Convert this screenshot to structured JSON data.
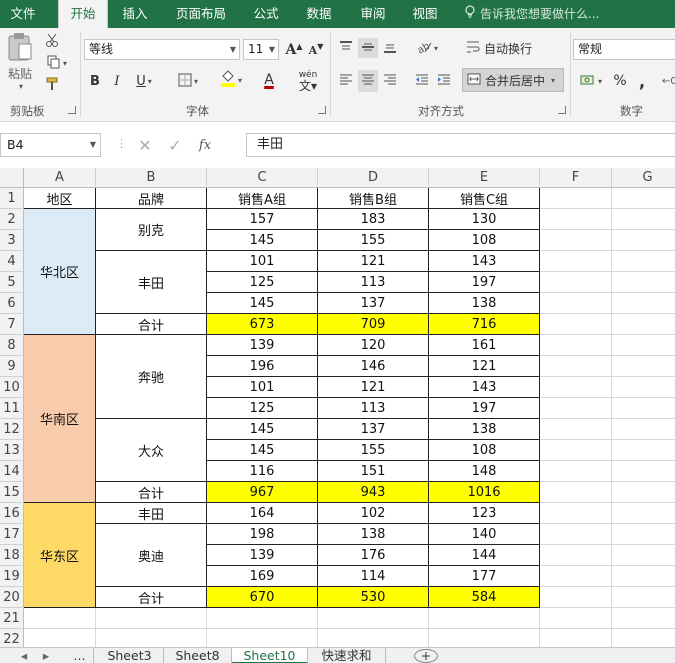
{
  "menu": {
    "tabs": [
      {
        "label": "文件"
      },
      {
        "label": "开始"
      },
      {
        "label": "插入"
      },
      {
        "label": "页面布局"
      },
      {
        "label": "公式"
      },
      {
        "label": "数据"
      },
      {
        "label": "审阅"
      },
      {
        "label": "视图"
      }
    ],
    "active_tab": "开始",
    "tell_me_placeholder": "告诉我您想要做什么..."
  },
  "ribbon": {
    "clipboard": {
      "paste_label": "粘贴",
      "group_label": "剪贴板"
    },
    "font": {
      "font_name": "等线",
      "font_size": "11",
      "grow_label": "A",
      "shrink_label": "A",
      "bold": "B",
      "italic": "I",
      "underline": "U",
      "font_color_letter": "A",
      "phonetic_label": "wén",
      "group_label": "字体"
    },
    "alignment": {
      "wrap_text_label": "自动换行",
      "merge_center_label": "合并后居中",
      "group_label": "对齐方式"
    },
    "number": {
      "format": "常规",
      "percent": "%",
      "comma": ",",
      "group_label": "数字"
    },
    "colors": {
      "accent": "#217346",
      "fill_swatch": "#ffff00",
      "font_swatch": "#c00000"
    }
  },
  "formula_bar": {
    "name_box": "B4",
    "fx_label": "fx",
    "value": "丰田"
  },
  "grid": {
    "columns": [
      "A",
      "B",
      "C",
      "D",
      "E",
      "F",
      "G"
    ],
    "rows": [
      "1",
      "2",
      "3",
      "4",
      "5",
      "6",
      "7",
      "8",
      "9",
      "10",
      "11",
      "12",
      "13",
      "14",
      "15",
      "16",
      "17",
      "18",
      "19",
      "20",
      "21",
      "22"
    ],
    "header": [
      "地区",
      "品牌",
      "销售A组",
      "销售B组",
      "销售C组"
    ],
    "regions": [
      {
        "name": "华北区",
        "color": "#ddebf7"
      },
      {
        "name": "华南区",
        "color": "#f8cbad"
      },
      {
        "name": "华东区",
        "color": "#ffd966"
      }
    ],
    "brands": [
      "别克",
      "丰田",
      "奔驰",
      "大众",
      "丰田",
      "奥迪"
    ],
    "subtotal_label": "合计",
    "data_rows": [
      [
        "157",
        "183",
        "130"
      ],
      [
        "145",
        "155",
        "108"
      ],
      [
        "101",
        "121",
        "143"
      ],
      [
        "125",
        "113",
        "197"
      ],
      [
        "145",
        "137",
        "138"
      ],
      [
        "673",
        "709",
        "716"
      ],
      [
        "139",
        "120",
        "161"
      ],
      [
        "196",
        "146",
        "121"
      ],
      [
        "101",
        "121",
        "143"
      ],
      [
        "125",
        "113",
        "197"
      ],
      [
        "145",
        "137",
        "138"
      ],
      [
        "145",
        "155",
        "108"
      ],
      [
        "116",
        "151",
        "148"
      ],
      [
        "967",
        "943",
        "1016"
      ],
      [
        "164",
        "102",
        "123"
      ],
      [
        "198",
        "138",
        "140"
      ],
      [
        "139",
        "176",
        "144"
      ],
      [
        "169",
        "114",
        "177"
      ],
      [
        "670",
        "530",
        "584"
      ]
    ],
    "subtotal_color": "#ffff00"
  },
  "sheet_tabs": {
    "nav_more": "...",
    "tabs": [
      "Sheet3",
      "Sheet8",
      "Sheet10",
      "快速求和"
    ],
    "active": "Sheet10",
    "add_label": "+"
  }
}
